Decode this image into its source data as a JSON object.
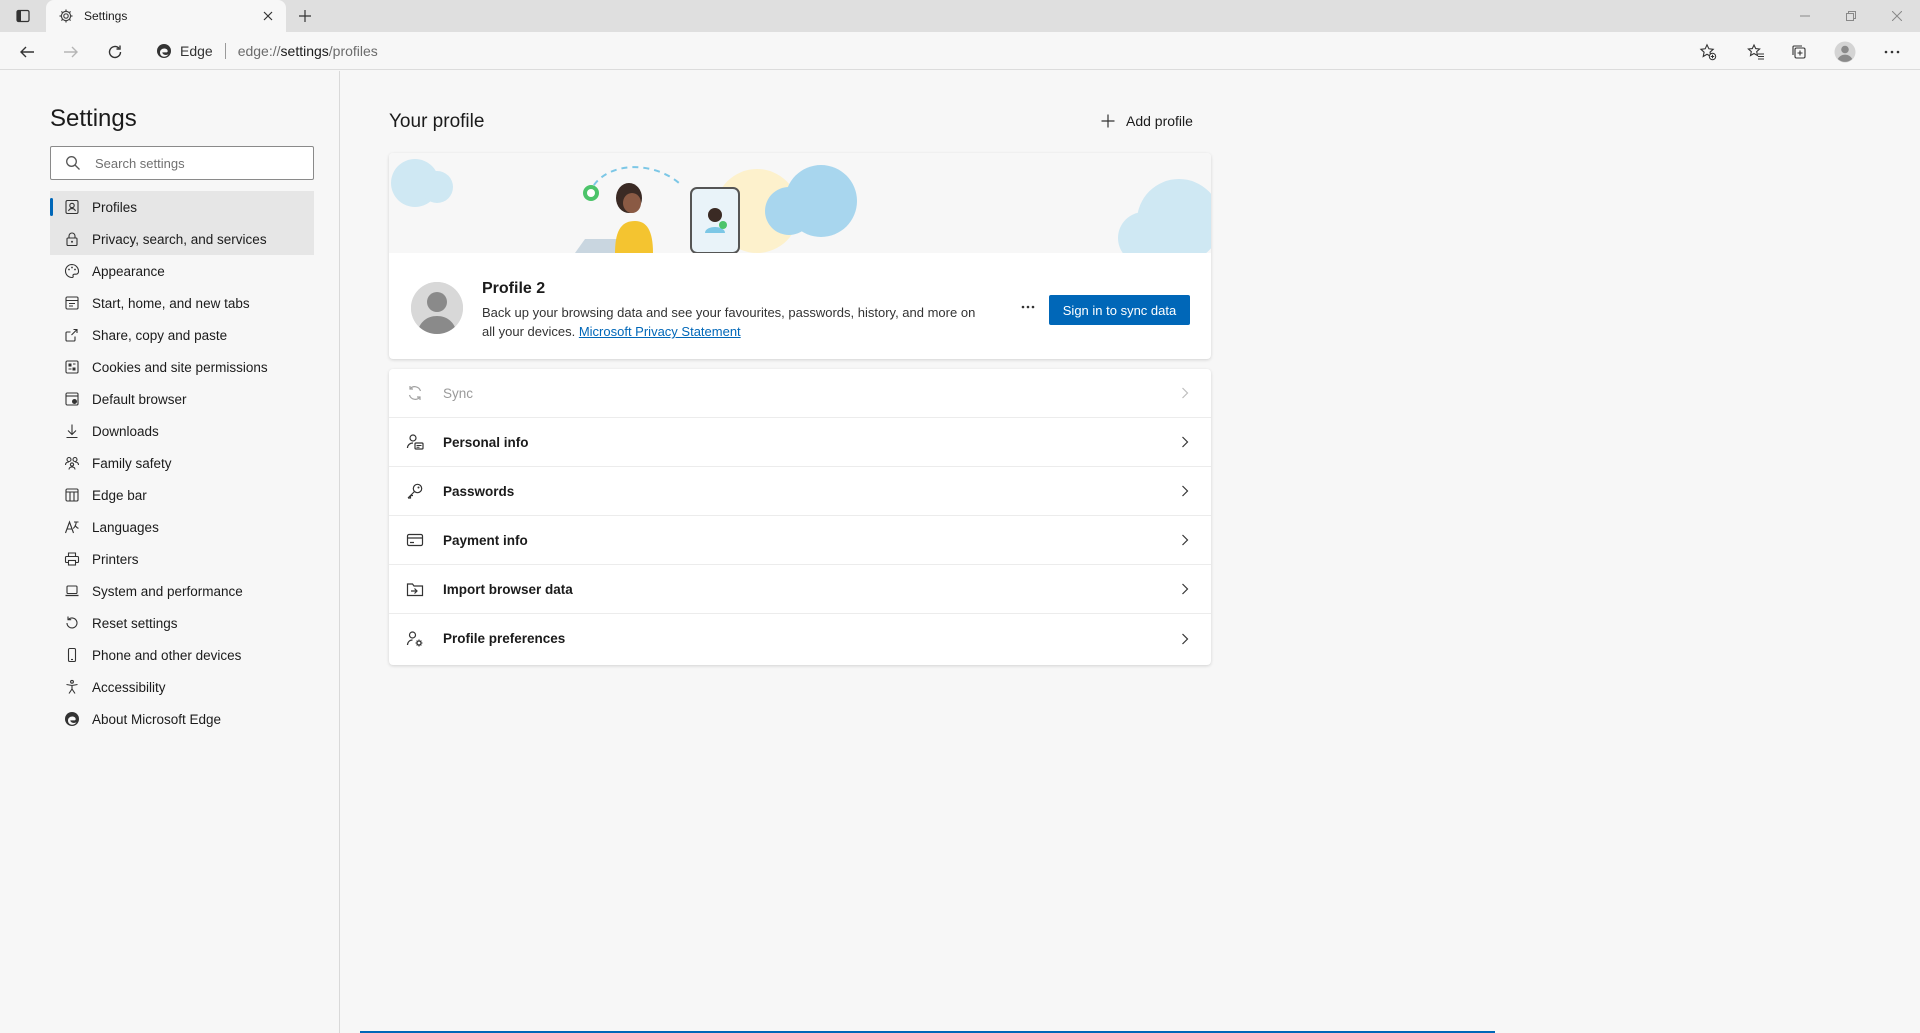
{
  "browser": {
    "tab_title": "Settings",
    "site_name": "Edge",
    "url_prefix": "edge://",
    "url_host": "settings",
    "url_path": "/profiles"
  },
  "sidebar": {
    "title": "Settings",
    "search_placeholder": "Search settings",
    "items": [
      {
        "label": "Profiles",
        "icon": "profile-icon"
      },
      {
        "label": "Privacy, search, and services",
        "icon": "lock-icon"
      },
      {
        "label": "Appearance",
        "icon": "palette-icon"
      },
      {
        "label": "Start, home, and new tabs",
        "icon": "home-icon"
      },
      {
        "label": "Share, copy and paste",
        "icon": "share-icon"
      },
      {
        "label": "Cookies and site permissions",
        "icon": "cookie-icon"
      },
      {
        "label": "Default browser",
        "icon": "browser-icon"
      },
      {
        "label": "Downloads",
        "icon": "download-icon"
      },
      {
        "label": "Family safety",
        "icon": "family-icon"
      },
      {
        "label": "Edge bar",
        "icon": "edge-bar-icon"
      },
      {
        "label": "Languages",
        "icon": "language-icon"
      },
      {
        "label": "Printers",
        "icon": "printer-icon"
      },
      {
        "label": "System and performance",
        "icon": "laptop-icon"
      },
      {
        "label": "Reset settings",
        "icon": "reset-icon"
      },
      {
        "label": "Phone and other devices",
        "icon": "phone-icon"
      },
      {
        "label": "Accessibility",
        "icon": "accessibility-icon"
      },
      {
        "label": "About Microsoft Edge",
        "icon": "edge-logo-icon"
      }
    ]
  },
  "main": {
    "title": "Your profile",
    "add_profile_label": "Add profile",
    "profile": {
      "name": "Profile 2",
      "description": "Back up your browsing data and see your favourites, passwords, history, and more on all your devices.",
      "privacy_link": "Microsoft Privacy Statement",
      "sync_button": "Sign in to sync data"
    },
    "rows": [
      {
        "label": "Sync",
        "icon": "sync-icon",
        "enabled": false
      },
      {
        "label": "Personal info",
        "icon": "personal-info-icon",
        "enabled": true
      },
      {
        "label": "Passwords",
        "icon": "key-icon",
        "enabled": true
      },
      {
        "label": "Payment info",
        "icon": "credit-card-icon",
        "enabled": true
      },
      {
        "label": "Import browser data",
        "icon": "import-icon",
        "enabled": true
      },
      {
        "label": "Profile preferences",
        "icon": "profile-settings-icon",
        "enabled": true
      }
    ]
  },
  "colors": {
    "accent": "#0067b8",
    "nav_highlight": "#e6e6e6"
  }
}
